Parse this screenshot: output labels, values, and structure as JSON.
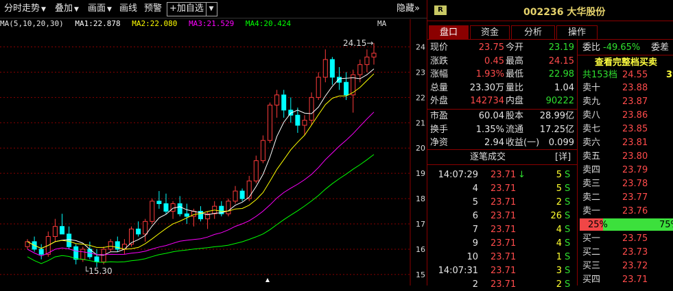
{
  "toolbar": {
    "items": [
      {
        "label": "分时走势",
        "has_arrow": true
      },
      {
        "label": "叠加",
        "has_arrow": true
      },
      {
        "label": "画面",
        "has_arrow": true
      },
      {
        "label": "画线",
        "has_arrow": false
      },
      {
        "label": "预警",
        "has_arrow": false
      }
    ],
    "add_watch": "+加自选",
    "hide_label": "隐藏",
    "hide_arrow": "»"
  },
  "ma_legend": {
    "prefix": "MA(5,10,20,30)",
    "ma1": "MA1:22.878",
    "ma2": "MA2:22.080",
    "ma3": "MA3:21.529",
    "ma4": "MA4:20.424",
    "corner": "MA"
  },
  "colors": {
    "up": "#ff3b3b",
    "down": "#00ffff",
    "ma1": "#ffffff",
    "ma2": "#ffff00",
    "ma3": "#ff00ff",
    "ma4": "#00ff00",
    "grid": "#8b0000"
  },
  "chart_data": {
    "type": "candlestick",
    "ylim": [
      14.7,
      24.5
    ],
    "yticks": [
      24,
      23,
      22,
      21,
      20,
      19,
      18,
      17,
      16,
      15
    ],
    "high_label": "24.15",
    "low_label": "15.30",
    "candles": [
      [
        16.1,
        16.4,
        16.0,
        16.3
      ],
      [
        16.3,
        16.5,
        15.9,
        16.0
      ],
      [
        16.0,
        16.2,
        15.6,
        15.8
      ],
      [
        15.8,
        16.7,
        15.7,
        16.5
      ],
      [
        16.5,
        17.2,
        16.3,
        16.9
      ],
      [
        16.9,
        17.4,
        16.6,
        16.6
      ],
      [
        16.6,
        16.9,
        16.0,
        16.1
      ],
      [
        16.1,
        16.2,
        15.4,
        15.6
      ],
      [
        15.6,
        16.1,
        15.5,
        16.0
      ],
      [
        16.0,
        16.3,
        15.6,
        15.7
      ],
      [
        15.7,
        16.0,
        15.3,
        15.5
      ],
      [
        15.5,
        16.1,
        15.4,
        16.0
      ],
      [
        16.0,
        16.4,
        15.9,
        16.3
      ],
      [
        16.3,
        16.5,
        15.9,
        16.0
      ],
      [
        16.0,
        16.4,
        15.8,
        16.2
      ],
      [
        16.2,
        16.9,
        16.1,
        16.8
      ],
      [
        16.8,
        17.1,
        16.5,
        16.6
      ],
      [
        16.6,
        17.2,
        16.3,
        17.1
      ],
      [
        17.1,
        18.0,
        17.0,
        17.9
      ],
      [
        17.9,
        18.3,
        17.6,
        17.8
      ],
      [
        17.8,
        18.2,
        17.4,
        17.5
      ],
      [
        17.5,
        17.9,
        17.2,
        17.8
      ],
      [
        17.8,
        18.1,
        17.3,
        17.4
      ],
      [
        17.4,
        17.8,
        17.0,
        17.3
      ],
      [
        17.3,
        17.6,
        16.9,
        17.5
      ],
      [
        17.5,
        17.7,
        17.1,
        17.2
      ],
      [
        17.2,
        17.5,
        16.8,
        17.4
      ],
      [
        17.4,
        17.9,
        17.2,
        17.7
      ],
      [
        17.7,
        17.9,
        17.3,
        17.4
      ],
      [
        17.4,
        18.0,
        17.3,
        17.9
      ],
      [
        17.9,
        18.5,
        17.8,
        18.3
      ],
      [
        18.3,
        18.4,
        17.9,
        18.0
      ],
      [
        18.0,
        18.9,
        17.9,
        18.7
      ],
      [
        18.7,
        19.7,
        18.6,
        19.5
      ],
      [
        19.5,
        20.5,
        19.4,
        20.3
      ],
      [
        20.3,
        21.8,
        20.2,
        21.7
      ],
      [
        21.7,
        22.3,
        21.2,
        22.1
      ],
      [
        22.1,
        22.3,
        21.2,
        21.5
      ],
      [
        21.5,
        22.0,
        21.0,
        21.3
      ],
      [
        21.3,
        21.6,
        20.6,
        20.9
      ],
      [
        20.9,
        21.3,
        20.5,
        21.1
      ],
      [
        21.1,
        22.2,
        20.9,
        22.0
      ],
      [
        22.0,
        23.0,
        21.9,
        22.8
      ],
      [
        22.8,
        23.9,
        22.6,
        23.5
      ],
      [
        23.5,
        23.6,
        22.5,
        22.8
      ],
      [
        22.8,
        23.2,
        22.3,
        22.6
      ],
      [
        22.6,
        23.0,
        21.9,
        22.1
      ],
      [
        22.1,
        23.1,
        21.4,
        22.9
      ],
      [
        22.9,
        23.5,
        22.6,
        23.3
      ],
      [
        23.3,
        23.9,
        23.0,
        23.6
      ],
      [
        23.6,
        24.15,
        23.3,
        23.75
      ]
    ]
  },
  "right_panel": {
    "badge": "R",
    "code": "002236",
    "name": "大华股份",
    "tabs": [
      "盘口",
      "资金",
      "分析",
      "操作"
    ],
    "quote": [
      {
        "l1": "现价",
        "v1": "23.75",
        "c1": "red",
        "l2": "今开",
        "v2": "23.19",
        "c2": "green"
      },
      {
        "l1": "涨跌",
        "v1": "0.45",
        "c1": "red",
        "l2": "最高",
        "v2": "24.15",
        "c2": "red"
      },
      {
        "l1": "涨幅",
        "v1": "1.93%",
        "c1": "red",
        "l2": "最低",
        "v2": "22.98",
        "c2": "green"
      },
      {
        "l1": "总量",
        "v1": "23.30万",
        "c1": "white",
        "l2": "量比",
        "v2": "1.04",
        "c2": "white"
      },
      {
        "l1": "外盘",
        "v1": "142734",
        "c1": "red",
        "l2": "内盘",
        "v2": "90222",
        "c2": "green"
      },
      {
        "l1": "市盈",
        "v1": "60.04",
        "c1": "white",
        "l2": "股本",
        "v2": "28.99亿",
        "c2": "white"
      },
      {
        "l1": "换手",
        "v1": "1.35%",
        "c1": "white",
        "l2": "流通",
        "v2": "17.25亿",
        "c2": "white"
      },
      {
        "l1": "净资",
        "v1": "2.94",
        "c1": "white",
        "l2": "收益(一)",
        "v2": "0.099",
        "c2": "white"
      }
    ],
    "ticks_title": "逐笔成交",
    "ticks_detail": "[详]",
    "ticks": [
      {
        "t": "14:07:29",
        "p": "23.71",
        "arrow": "↓",
        "v": "5",
        "s": "S"
      },
      {
        "t": "4",
        "p": "23.71",
        "arrow": "",
        "v": "5",
        "s": "S"
      },
      {
        "t": "5",
        "p": "23.71",
        "arrow": "",
        "v": "2",
        "s": "S"
      },
      {
        "t": "6",
        "p": "23.71",
        "arrow": "",
        "v": "26",
        "s": "S"
      },
      {
        "t": "7",
        "p": "23.71",
        "arrow": "",
        "v": "4",
        "s": "S"
      },
      {
        "t": "9",
        "p": "23.71",
        "arrow": "",
        "v": "4",
        "s": "S"
      },
      {
        "t": "10",
        "p": "23.71",
        "arrow": "",
        "v": "1",
        "s": "S"
      },
      {
        "t": "14:07:31",
        "p": "23.71",
        "arrow": "",
        "v": "3",
        "s": "S"
      },
      {
        "t": "2",
        "p": "23.71",
        "arrow": "",
        "v": "2",
        "s": "S"
      }
    ],
    "weibi_label": "委比",
    "weibi_value": "-49.65%",
    "weicha_label": "委差",
    "full_depth": "查看完整档买卖",
    "extra_value": "39",
    "levels_label": "共153档",
    "levels_price": "24.55",
    "asks": [
      {
        "l": "卖十",
        "p": "23.88"
      },
      {
        "l": "卖九",
        "p": "23.87"
      },
      {
        "l": "卖八",
        "p": "23.86"
      },
      {
        "l": "卖七",
        "p": "23.85"
      },
      {
        "l": "卖六",
        "p": "23.81"
      },
      {
        "l": "卖五",
        "p": "23.80"
      },
      {
        "l": "卖四",
        "p": "23.79"
      },
      {
        "l": "卖三",
        "p": "23.78"
      },
      {
        "l": "卖二",
        "p": "23.77"
      },
      {
        "l": "卖一",
        "p": "23.76"
      }
    ],
    "ratio_left": "25%",
    "ratio_right": "75%",
    "ratio_fraction": 0.25,
    "bids": [
      {
        "l": "买一",
        "p": "23.75"
      },
      {
        "l": "买二",
        "p": "23.73"
      },
      {
        "l": "买三",
        "p": "23.72"
      },
      {
        "l": "买四",
        "p": "23.71"
      }
    ]
  }
}
